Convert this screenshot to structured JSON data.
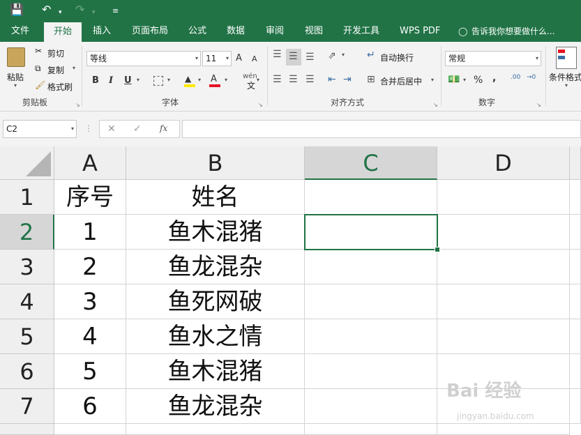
{
  "quick_access": {
    "save_icon": "save-icon",
    "undo_icon": "undo-icon",
    "redo_icon": "redo-icon",
    "customize_icon": "customize-qat-icon"
  },
  "menu": {
    "tabs": [
      "文件",
      "开始",
      "插入",
      "页面布局",
      "公式",
      "数据",
      "审阅",
      "视图",
      "开发工具",
      "WPS PDF"
    ],
    "active": "开始",
    "tell_me": "告诉我你想要做什么..."
  },
  "ribbon": {
    "clipboard": {
      "paste": "粘贴",
      "cut": "剪切",
      "copy": "复制",
      "format_painter": "格式刷",
      "label": "剪贴板"
    },
    "font": {
      "name": "等线",
      "size": "11",
      "grow": "A",
      "shrink": "A",
      "bold": "B",
      "italic": "I",
      "underline": "U",
      "pinyin": "wén",
      "label": "字体"
    },
    "alignment": {
      "wrap": "自动换行",
      "merge": "合并后居中",
      "label": "对齐方式"
    },
    "number": {
      "format": "常规",
      "percent": "%",
      "comma": ",",
      "inc_dec": ".00",
      "label": "数字"
    },
    "styles": {
      "conditional": "条件格式"
    }
  },
  "formula_bar": {
    "name_box": "C2",
    "cancel": "✕",
    "enter": "✓",
    "fx": "fx",
    "content": ""
  },
  "sheet": {
    "columns": [
      "A",
      "B",
      "C",
      "D"
    ],
    "selected_column": "C",
    "rows": [
      {
        "num": "1",
        "a": "序号",
        "b": "姓名"
      },
      {
        "num": "2",
        "a": "1",
        "b": "鱼木混猪"
      },
      {
        "num": "3",
        "a": "2",
        "b": "鱼龙混杂"
      },
      {
        "num": "4",
        "a": "3",
        "b": "鱼死网破"
      },
      {
        "num": "5",
        "a": "4",
        "b": "鱼水之情"
      },
      {
        "num": "6",
        "a": "5",
        "b": "鱼木混猪"
      },
      {
        "num": "7",
        "a": "6",
        "b": "鱼龙混杂"
      }
    ],
    "selected_row": "2",
    "active_cell": "C2"
  },
  "watermark": {
    "brand": "Bai 经验",
    "url": "jingyan.baidu.com"
  }
}
